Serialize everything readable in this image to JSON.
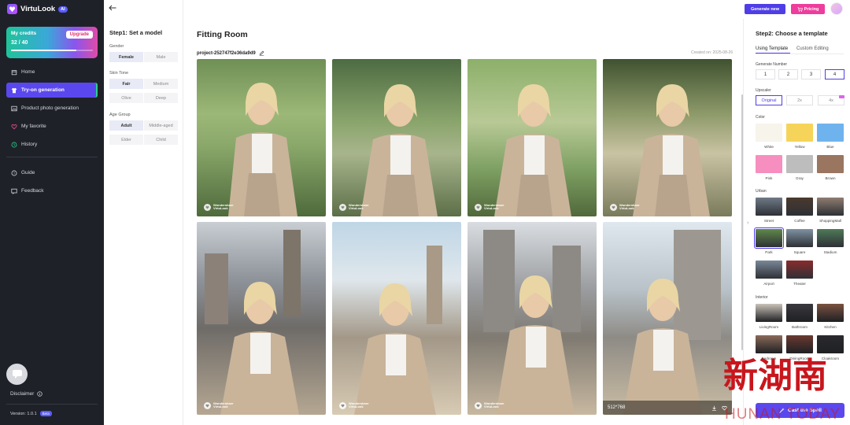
{
  "app": {
    "name": "VirtuLook",
    "badge": "AI"
  },
  "credits": {
    "title": "My credits",
    "count": "32 / 40",
    "progress_fraction": 0.8,
    "upgrade_label": "Upgrade"
  },
  "nav": {
    "home": "Home",
    "tryon": "Try-on generation",
    "product": "Product photo generation",
    "favorite": "My favorite",
    "history": "History",
    "guide": "Guide",
    "feedback": "Feedback"
  },
  "footer": {
    "disclaimer": "Disclaimer",
    "version": "Version: 1.0.1",
    "beta": "Beta"
  },
  "step1": {
    "title": "Step1: Set a model",
    "gender": {
      "label": "Gender",
      "options": [
        "Female",
        "Male"
      ],
      "selected": "Female"
    },
    "skin": {
      "label": "Skin Tone",
      "options": [
        "Fair",
        "Medium",
        "Olive",
        "Deep"
      ],
      "selected": "Fair"
    },
    "age": {
      "label": "Age Group",
      "options": [
        "Adult",
        "Middle-aged",
        "Elder",
        "Child"
      ],
      "selected": "Adult"
    }
  },
  "main": {
    "title": "Fitting Room",
    "project_id": "project-252747f2e36da9d9",
    "created": "Created on: 2025-08-26",
    "watermark": {
      "line1": "Wondershare",
      "line2": "VirtuLook"
    },
    "resolution": "512*768"
  },
  "topbar": {
    "generate_new": "Generate new",
    "pricing": "Pricing"
  },
  "step2": {
    "title": "Step2: Choose a template",
    "tabs": [
      "Using Template",
      "Custom Editing"
    ],
    "generate_number": {
      "label": "Generate Number",
      "options": [
        "1",
        "2",
        "3",
        "4"
      ],
      "selected": "4"
    },
    "upscaler": {
      "label": "Upscaler",
      "options": [
        "Original",
        "2x",
        "4x"
      ],
      "selected": "Original"
    },
    "color": {
      "label": "Color",
      "items": [
        {
          "name": "White",
          "color": "#f7f4ec"
        },
        {
          "name": "Yellow",
          "color": "#f6d45a"
        },
        {
          "name": "Blue",
          "color": "#6fb3ee"
        },
        {
          "name": "Pink",
          "color": "#f68fbf"
        },
        {
          "name": "Gray",
          "color": "#bdbdbd"
        },
        {
          "name": "Brown",
          "color": "#9a7560"
        }
      ]
    },
    "urban": {
      "label": "Urban",
      "items": [
        "Street",
        "Coffee",
        "ShoppingMall",
        "Park",
        "Square",
        "Stadium",
        "Airport",
        "Theater"
      ],
      "selected": "Park"
    },
    "interior": {
      "label": "Interior",
      "items": [
        "LivingRoom",
        "Bathroom",
        "Kitchen",
        "Bedroom",
        "DiningRoom",
        "Cloakroom"
      ]
    },
    "cast_button": "Cast the Spell"
  },
  "overlay": {
    "brand_cn": "新湖南",
    "brand_en": "HUNAN TODAY"
  }
}
